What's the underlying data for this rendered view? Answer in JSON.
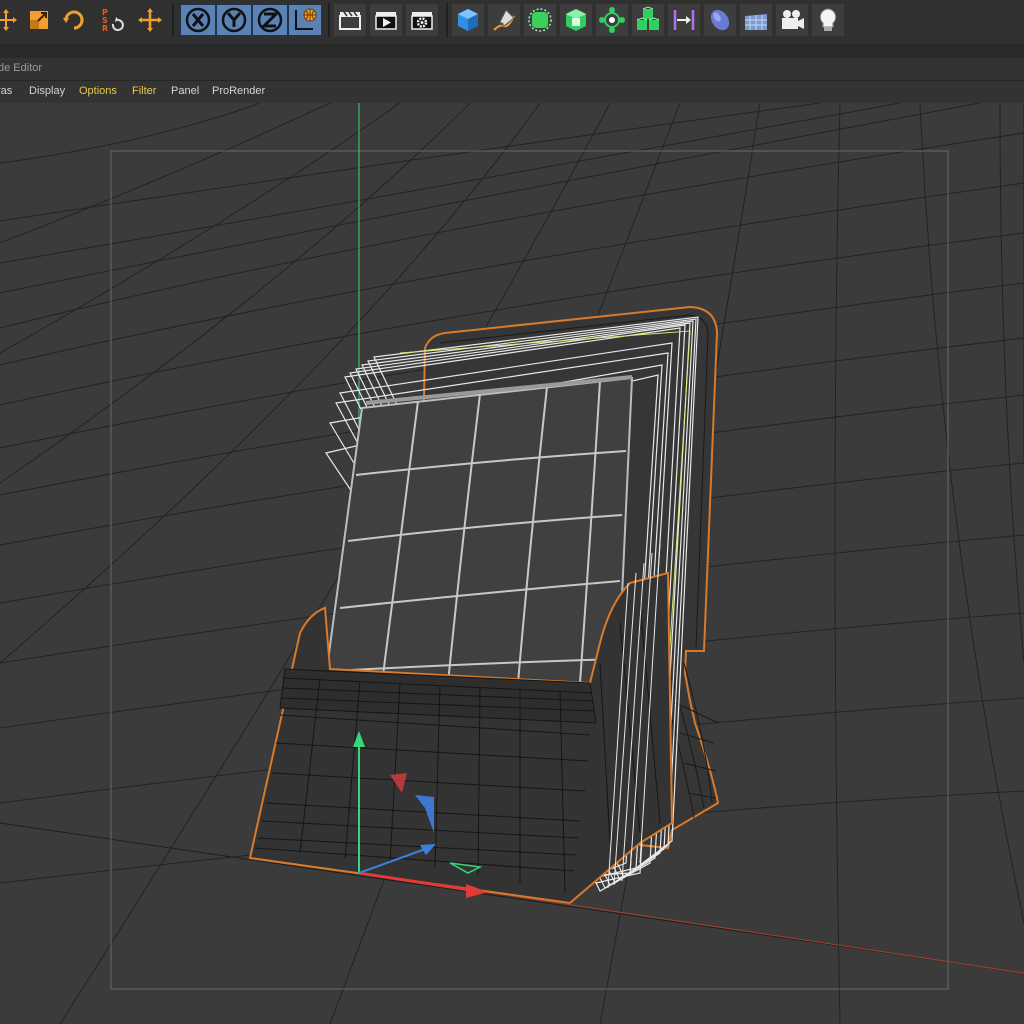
{
  "window": {
    "title": "de Editor"
  },
  "toolbar": {
    "buttons": [
      {
        "name": "move-tool-button",
        "icon": "move-arrows-icon"
      },
      {
        "name": "scale-tool-button",
        "icon": "scale-icon"
      },
      {
        "name": "rotate-tool-button",
        "icon": "rotate-icon"
      },
      {
        "name": "psr-button",
        "icon": "psr-icon"
      },
      {
        "name": "move-cross-button",
        "icon": "move-cross-icon"
      },
      {
        "name": "x-axis-button",
        "icon": "x-axis-icon"
      },
      {
        "name": "y-axis-button",
        "icon": "y-axis-icon"
      },
      {
        "name": "z-axis-button",
        "icon": "z-axis-icon"
      },
      {
        "name": "world-coordinates-button",
        "icon": "world-coordinates-icon"
      },
      {
        "name": "render-view-button",
        "icon": "clapboard-icon"
      },
      {
        "name": "render-picture-viewer-button",
        "icon": "render-play-icon"
      },
      {
        "name": "render-settings-button",
        "icon": "render-settings-icon"
      },
      {
        "name": "cube-button",
        "icon": "cube-icon"
      },
      {
        "name": "pen-button",
        "icon": "pen-icon"
      },
      {
        "name": "subdivision-button",
        "icon": "subdivision-icon"
      },
      {
        "name": "generator-button",
        "icon": "generator-icon"
      },
      {
        "name": "mograph-button",
        "icon": "mograph-icon"
      },
      {
        "name": "cloner-button",
        "icon": "cloner-icon"
      },
      {
        "name": "deformer-button",
        "icon": "deformer-icon"
      },
      {
        "name": "environment-button",
        "icon": "environment-icon"
      },
      {
        "name": "floor-button",
        "icon": "floor-icon"
      },
      {
        "name": "camera-button",
        "icon": "camera-icon"
      },
      {
        "name": "light-button",
        "icon": "light-bulb-icon"
      }
    ],
    "colors": {
      "accent": "#f0a030",
      "axis_button": "#5a82b4"
    }
  },
  "menu": {
    "items": [
      "ras",
      "Display",
      "Options",
      "Filter",
      "Panel",
      "ProRender"
    ]
  },
  "colors": {
    "viewport_bg": "#3b3b3b",
    "y_axis": "#36d67a",
    "x_axis": "#e03a3a",
    "z_axis": "#3d7fe0",
    "selection_outline": "#d77a2a"
  }
}
